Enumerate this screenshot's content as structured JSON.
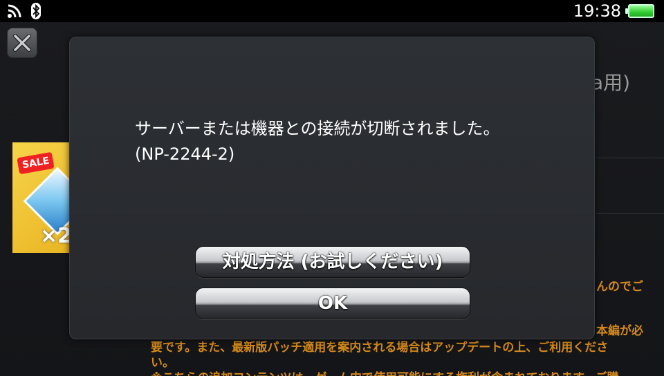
{
  "status_bar": {
    "time": "19:38",
    "icons": [
      "wifi-icon",
      "bluetooth-icon",
      "battery-icon"
    ]
  },
  "background": {
    "title_tail": "a用)",
    "text_lines": [
      "んのでご",
      "本編が必",
      "要です。また、最新版パッチ適用を案内される場合はアップデートの上、ご利用くださ",
      "い。",
      "※こちらの追加コンテンツは、ゲーム内で使用可能にする権利が含まれております。ご購"
    ],
    "thumbnail": {
      "badge": "SALE",
      "multiplier": "×2"
    }
  },
  "dialog": {
    "message": "サーバーまたは機器との接続が切断されました。",
    "error_code": "(NP-2244-2)",
    "help_button_label": "対処方法 (お試しください)",
    "ok_button_label": "OK"
  },
  "colors": {
    "dialog_background": "#2a2c30",
    "background_text": "#d48a1a",
    "battery": "#3c3"
  }
}
